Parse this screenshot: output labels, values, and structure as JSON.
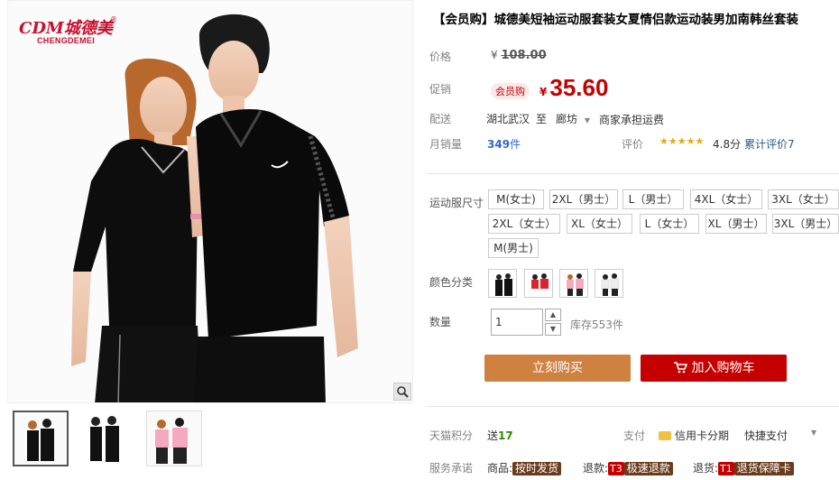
{
  "brand": {
    "logo_text": "CDM城德美",
    "logo_sub": "CHENGDEMEI",
    "logo_reg": "®"
  },
  "product": {
    "title": "【会员购】城德美短袖运动服套装女夏情侣款运动装男加南韩丝套装"
  },
  "price": {
    "label": "价格",
    "currency": "¥",
    "original": "108.00"
  },
  "promo": {
    "label": "促销",
    "badge": "会员购",
    "currency": "¥",
    "price": "35.60"
  },
  "delivery": {
    "label": "配送",
    "from": "湖北武汉",
    "to_word": "至",
    "destination": "廊坊",
    "shipping_note": "商家承担运费"
  },
  "sales": {
    "label": "月销量",
    "count": "349",
    "unit": "件"
  },
  "rating": {
    "label": "评价",
    "stars": "★★★★★",
    "score": "4.8分",
    "reviews_link": "累计评价7"
  },
  "size": {
    "label": "运动服尺寸",
    "options": [
      "M(女士)",
      "2XL（男士）",
      "L（男士）",
      "4XL（女士）",
      "3XL（女士）",
      "2XL（女士）",
      "XL（女士）",
      "L（女士）",
      "XL（男士）",
      "3XL（男士）",
      "M(男士)"
    ]
  },
  "color": {
    "label": "颜色分类"
  },
  "quantity": {
    "label": "数量",
    "value": "1",
    "up_symbol": "▲",
    "down_symbol": "▼",
    "stock_text": "库存553件"
  },
  "actions": {
    "buy_now": "立刻购买",
    "add_to_cart": "加入购物车"
  },
  "points": {
    "label": "天猫积分",
    "send_word": "送",
    "value": "17"
  },
  "payment": {
    "label": "支付",
    "credit_card": "信用卡分期",
    "quick_pay": "快捷支付"
  },
  "service": {
    "label": "服务承诺",
    "goods_label": "商品:",
    "goods_tag": "按时发货",
    "refund_label": "退款:",
    "refund_code": "T3",
    "refund_tag": "极速退款",
    "return_label": "退货:",
    "return_code": "T1",
    "return_tag": "退货保障卡"
  },
  "colors": {
    "price_red": "#c40000",
    "buy_orange": "#cf8140",
    "cart_red": "#c40000",
    "sales_blue": "#3366cc",
    "points_green": "#2e8b00"
  }
}
